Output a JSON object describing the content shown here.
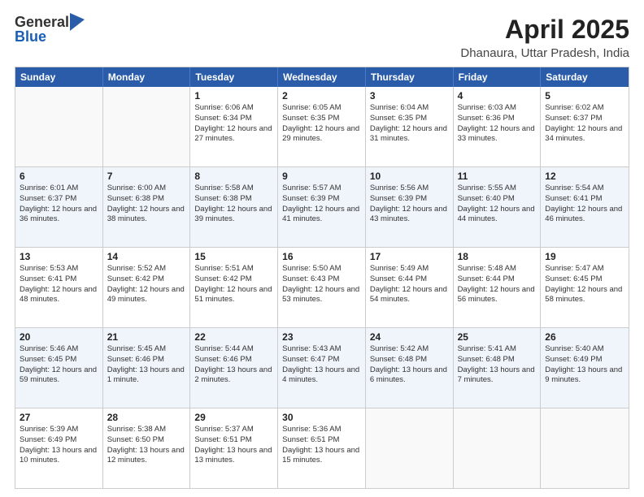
{
  "logo": {
    "general": "General",
    "blue": "Blue"
  },
  "title": "April 2025",
  "location": "Dhanaura, Uttar Pradesh, India",
  "weekdays": [
    "Sunday",
    "Monday",
    "Tuesday",
    "Wednesday",
    "Thursday",
    "Friday",
    "Saturday"
  ],
  "rows": [
    [
      {
        "day": "",
        "sunrise": "",
        "sunset": "",
        "daylight": ""
      },
      {
        "day": "",
        "sunrise": "",
        "sunset": "",
        "daylight": ""
      },
      {
        "day": "1",
        "sunrise": "Sunrise: 6:06 AM",
        "sunset": "Sunset: 6:34 PM",
        "daylight": "Daylight: 12 hours and 27 minutes."
      },
      {
        "day": "2",
        "sunrise": "Sunrise: 6:05 AM",
        "sunset": "Sunset: 6:35 PM",
        "daylight": "Daylight: 12 hours and 29 minutes."
      },
      {
        "day": "3",
        "sunrise": "Sunrise: 6:04 AM",
        "sunset": "Sunset: 6:35 PM",
        "daylight": "Daylight: 12 hours and 31 minutes."
      },
      {
        "day": "4",
        "sunrise": "Sunrise: 6:03 AM",
        "sunset": "Sunset: 6:36 PM",
        "daylight": "Daylight: 12 hours and 33 minutes."
      },
      {
        "day": "5",
        "sunrise": "Sunrise: 6:02 AM",
        "sunset": "Sunset: 6:37 PM",
        "daylight": "Daylight: 12 hours and 34 minutes."
      }
    ],
    [
      {
        "day": "6",
        "sunrise": "Sunrise: 6:01 AM",
        "sunset": "Sunset: 6:37 PM",
        "daylight": "Daylight: 12 hours and 36 minutes."
      },
      {
        "day": "7",
        "sunrise": "Sunrise: 6:00 AM",
        "sunset": "Sunset: 6:38 PM",
        "daylight": "Daylight: 12 hours and 38 minutes."
      },
      {
        "day": "8",
        "sunrise": "Sunrise: 5:58 AM",
        "sunset": "Sunset: 6:38 PM",
        "daylight": "Daylight: 12 hours and 39 minutes."
      },
      {
        "day": "9",
        "sunrise": "Sunrise: 5:57 AM",
        "sunset": "Sunset: 6:39 PM",
        "daylight": "Daylight: 12 hours and 41 minutes."
      },
      {
        "day": "10",
        "sunrise": "Sunrise: 5:56 AM",
        "sunset": "Sunset: 6:39 PM",
        "daylight": "Daylight: 12 hours and 43 minutes."
      },
      {
        "day": "11",
        "sunrise": "Sunrise: 5:55 AM",
        "sunset": "Sunset: 6:40 PM",
        "daylight": "Daylight: 12 hours and 44 minutes."
      },
      {
        "day": "12",
        "sunrise": "Sunrise: 5:54 AM",
        "sunset": "Sunset: 6:41 PM",
        "daylight": "Daylight: 12 hours and 46 minutes."
      }
    ],
    [
      {
        "day": "13",
        "sunrise": "Sunrise: 5:53 AM",
        "sunset": "Sunset: 6:41 PM",
        "daylight": "Daylight: 12 hours and 48 minutes."
      },
      {
        "day": "14",
        "sunrise": "Sunrise: 5:52 AM",
        "sunset": "Sunset: 6:42 PM",
        "daylight": "Daylight: 12 hours and 49 minutes."
      },
      {
        "day": "15",
        "sunrise": "Sunrise: 5:51 AM",
        "sunset": "Sunset: 6:42 PM",
        "daylight": "Daylight: 12 hours and 51 minutes."
      },
      {
        "day": "16",
        "sunrise": "Sunrise: 5:50 AM",
        "sunset": "Sunset: 6:43 PM",
        "daylight": "Daylight: 12 hours and 53 minutes."
      },
      {
        "day": "17",
        "sunrise": "Sunrise: 5:49 AM",
        "sunset": "Sunset: 6:44 PM",
        "daylight": "Daylight: 12 hours and 54 minutes."
      },
      {
        "day": "18",
        "sunrise": "Sunrise: 5:48 AM",
        "sunset": "Sunset: 6:44 PM",
        "daylight": "Daylight: 12 hours and 56 minutes."
      },
      {
        "day": "19",
        "sunrise": "Sunrise: 5:47 AM",
        "sunset": "Sunset: 6:45 PM",
        "daylight": "Daylight: 12 hours and 58 minutes."
      }
    ],
    [
      {
        "day": "20",
        "sunrise": "Sunrise: 5:46 AM",
        "sunset": "Sunset: 6:45 PM",
        "daylight": "Daylight: 12 hours and 59 minutes."
      },
      {
        "day": "21",
        "sunrise": "Sunrise: 5:45 AM",
        "sunset": "Sunset: 6:46 PM",
        "daylight": "Daylight: 13 hours and 1 minute."
      },
      {
        "day": "22",
        "sunrise": "Sunrise: 5:44 AM",
        "sunset": "Sunset: 6:46 PM",
        "daylight": "Daylight: 13 hours and 2 minutes."
      },
      {
        "day": "23",
        "sunrise": "Sunrise: 5:43 AM",
        "sunset": "Sunset: 6:47 PM",
        "daylight": "Daylight: 13 hours and 4 minutes."
      },
      {
        "day": "24",
        "sunrise": "Sunrise: 5:42 AM",
        "sunset": "Sunset: 6:48 PM",
        "daylight": "Daylight: 13 hours and 6 minutes."
      },
      {
        "day": "25",
        "sunrise": "Sunrise: 5:41 AM",
        "sunset": "Sunset: 6:48 PM",
        "daylight": "Daylight: 13 hours and 7 minutes."
      },
      {
        "day": "26",
        "sunrise": "Sunrise: 5:40 AM",
        "sunset": "Sunset: 6:49 PM",
        "daylight": "Daylight: 13 hours and 9 minutes."
      }
    ],
    [
      {
        "day": "27",
        "sunrise": "Sunrise: 5:39 AM",
        "sunset": "Sunset: 6:49 PM",
        "daylight": "Daylight: 13 hours and 10 minutes."
      },
      {
        "day": "28",
        "sunrise": "Sunrise: 5:38 AM",
        "sunset": "Sunset: 6:50 PM",
        "daylight": "Daylight: 13 hours and 12 minutes."
      },
      {
        "day": "29",
        "sunrise": "Sunrise: 5:37 AM",
        "sunset": "Sunset: 6:51 PM",
        "daylight": "Daylight: 13 hours and 13 minutes."
      },
      {
        "day": "30",
        "sunrise": "Sunrise: 5:36 AM",
        "sunset": "Sunset: 6:51 PM",
        "daylight": "Daylight: 13 hours and 15 minutes."
      },
      {
        "day": "",
        "sunrise": "",
        "sunset": "",
        "daylight": ""
      },
      {
        "day": "",
        "sunrise": "",
        "sunset": "",
        "daylight": ""
      },
      {
        "day": "",
        "sunrise": "",
        "sunset": "",
        "daylight": ""
      }
    ]
  ]
}
